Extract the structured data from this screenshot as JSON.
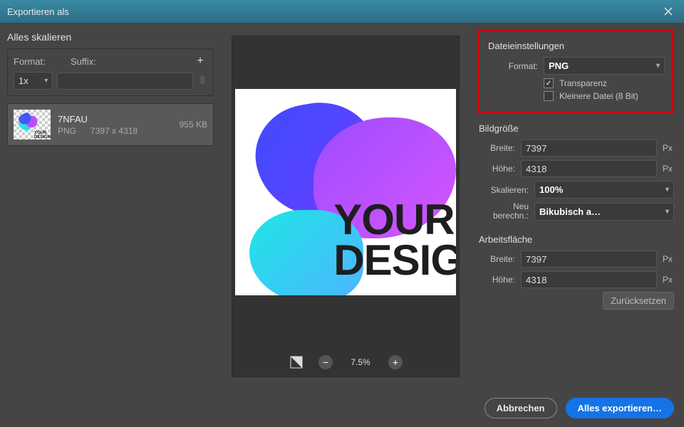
{
  "titlebar": {
    "title": "Exportieren als"
  },
  "left": {
    "section_title": "Alles skalieren",
    "format_label": "Format:",
    "suffix_label": "Suffix:",
    "scale_value": "1x",
    "suffix_value": "",
    "asset": {
      "name": "7NFAU",
      "format": "PNG",
      "dims": "7397 x 4318",
      "size": "955 KB",
      "thumb_text": "YOUR\nDESIGN"
    }
  },
  "preview": {
    "zoom": "7.5%",
    "art_line1": "YOUR",
    "art_line2": "DESIG"
  },
  "right": {
    "file_settings_title": "Dateieinstellungen",
    "format_label": "Format:",
    "format_value": "PNG",
    "transparency_label": "Transparenz",
    "transparency_checked": true,
    "smaller_label": "Kleinere Datei (8 Bit)",
    "smaller_checked": false,
    "image_size_title": "Bildgröße",
    "width_label": "Breite:",
    "height_label": "Höhe:",
    "scale_label": "Skalieren:",
    "resample_label": "Neu berechn.:",
    "width_value": "7397",
    "height_value": "4318",
    "scale_value": "100%",
    "resample_value": "Bikubisch a…",
    "unit": "Px",
    "canvas_title": "Arbeitsfläche",
    "canvas_width": "7397",
    "canvas_height": "4318",
    "reset_label": "Zurücksetzen",
    "cancel_label": "Abbrechen",
    "export_label": "Alles exportieren…"
  }
}
